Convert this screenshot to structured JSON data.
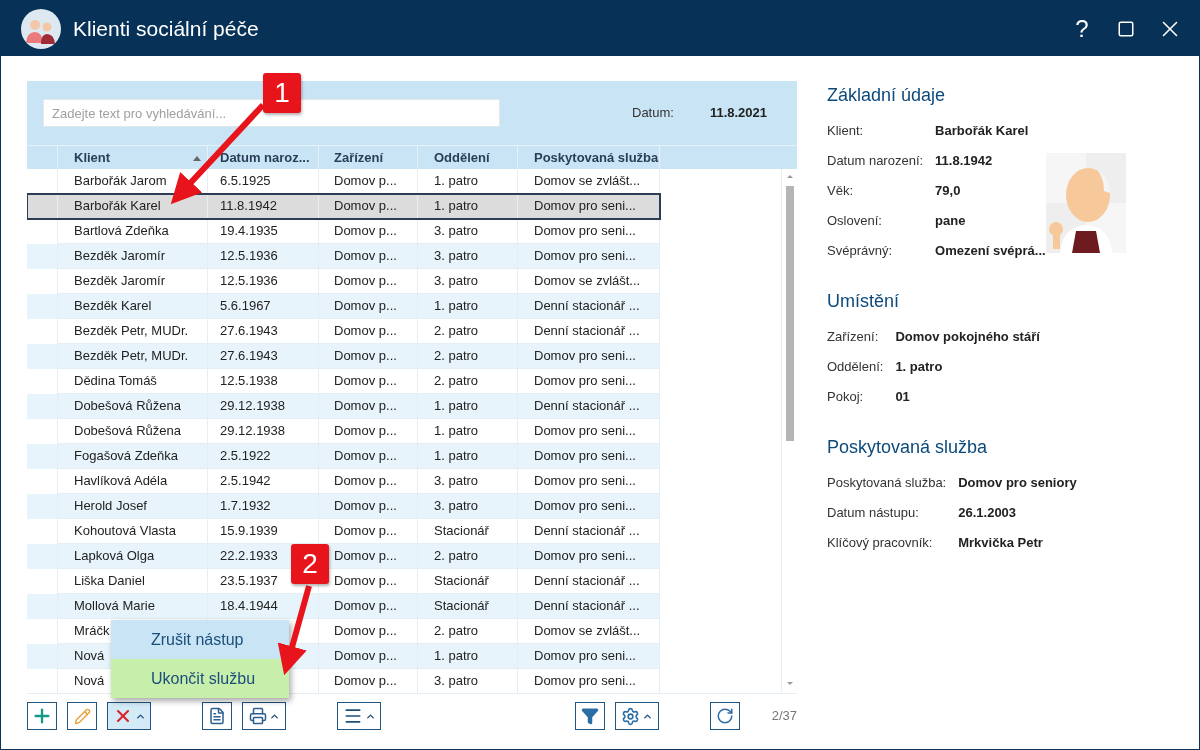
{
  "window": {
    "title": "Klienti sociální péče",
    "help": "?"
  },
  "search": {
    "placeholder": "Zadejte text pro vyhledávání..."
  },
  "date": {
    "label": "Datum:",
    "value": "11.8.2021"
  },
  "table": {
    "columns": [
      {
        "label": "Klient",
        "sorted": true
      },
      {
        "label": "Datum naroz...",
        "sorted": false
      },
      {
        "label": "Zařízení",
        "sorted": false
      },
      {
        "label": "Oddělení",
        "sorted": false
      },
      {
        "label": "Poskytovaná služba",
        "sorted": false
      }
    ],
    "rows": [
      {
        "cells": [
          "Barbořák Jarom",
          "6.5.1925",
          "Domov p...",
          "1. patro",
          "Domov se zvlášt..."
        ],
        "selected": false
      },
      {
        "cells": [
          "Barbořák Karel",
          "11.8.1942",
          "Domov p...",
          "1. patro",
          "Domov pro seni..."
        ],
        "selected": true
      },
      {
        "cells": [
          "Bartlová Zdeňka",
          "19.4.1935",
          "Domov p...",
          "3. patro",
          "Domov pro seni..."
        ],
        "selected": false
      },
      {
        "cells": [
          "Bezděk Jaromír",
          "12.5.1936",
          "Domov p...",
          "3. patro",
          "Domov pro seni..."
        ],
        "selected": false
      },
      {
        "cells": [
          "Bezděk Jaromír",
          "12.5.1936",
          "Domov p...",
          "3. patro",
          "Domov se zvlášt..."
        ],
        "selected": false
      },
      {
        "cells": [
          "Bezděk Karel",
          "5.6.1967",
          "Domov p...",
          "1. patro",
          "Denní stacionář ..."
        ],
        "selected": false
      },
      {
        "cells": [
          "Bezděk Petr, MUDr.",
          "27.6.1943",
          "Domov p...",
          "2. patro",
          "Denní stacionář ..."
        ],
        "selected": false
      },
      {
        "cells": [
          "Bezděk Petr, MUDr.",
          "27.6.1943",
          "Domov p...",
          "2. patro",
          "Domov pro seni..."
        ],
        "selected": false
      },
      {
        "cells": [
          "Dědina Tomáš",
          "12.5.1938",
          "Domov p...",
          "2. patro",
          "Domov pro seni..."
        ],
        "selected": false
      },
      {
        "cells": [
          "Dobešová Růžena",
          "29.12.1938",
          "Domov p...",
          "1. patro",
          "Denní stacionář ..."
        ],
        "selected": false
      },
      {
        "cells": [
          "Dobešová Růžena",
          "29.12.1938",
          "Domov p...",
          "1. patro",
          "Domov pro seni..."
        ],
        "selected": false
      },
      {
        "cells": [
          "Fogašová Zdeňka",
          "2.5.1922",
          "Domov p...",
          "1. patro",
          "Domov pro seni..."
        ],
        "selected": false
      },
      {
        "cells": [
          "Havlíková Adéla",
          "2.5.1942",
          "Domov p...",
          "3. patro",
          "Domov pro seni..."
        ],
        "selected": false
      },
      {
        "cells": [
          "Herold Josef",
          "1.7.1932",
          "Domov p...",
          "3. patro",
          "Domov pro seni..."
        ],
        "selected": false
      },
      {
        "cells": [
          "Kohoutová Vlasta",
          "15.9.1939",
          "Domov p...",
          "Stacionář",
          "Denní stacionář ..."
        ],
        "selected": false
      },
      {
        "cells": [
          "Lapková Olga",
          "22.2.1933",
          "Domov p...",
          "2. patro",
          "Domov pro seni..."
        ],
        "selected": false
      },
      {
        "cells": [
          "Liška Daniel",
          "23.5.1937",
          "Domov p...",
          "Stacionář",
          "Denní stacionář ..."
        ],
        "selected": false
      },
      {
        "cells": [
          "Mollová Marie",
          "18.4.1944",
          "Domov p...",
          "Stacionář",
          "Denní stacionář ..."
        ],
        "selected": false
      },
      {
        "cells": [
          "Mráčk",
          null,
          "Domov p...",
          "2. patro",
          "Domov se zvlášt..."
        ],
        "selected": false
      },
      {
        "cells": [
          "Nová",
          null,
          "Domov p...",
          "1. patro",
          "Domov pro seni..."
        ],
        "selected": false
      },
      {
        "cells": [
          "Nová",
          null,
          "Domov p...",
          "3. patro",
          "Domov pro seni..."
        ],
        "selected": false
      }
    ]
  },
  "toolbar": {
    "groups": [
      [
        {
          "kind": "add",
          "dropdown": false,
          "pressed": false
        },
        {
          "kind": "edit",
          "dropdown": false,
          "pressed": false
        },
        {
          "kind": "delete",
          "dropdown": true,
          "pressed": true
        }
      ],
      [
        {
          "kind": "document",
          "dropdown": false,
          "pressed": false
        },
        {
          "kind": "print",
          "dropdown": true,
          "pressed": false
        }
      ],
      [
        {
          "kind": "menu",
          "dropdown": true,
          "pressed": false
        }
      ],
      [
        {
          "kind": "filter",
          "dropdown": false,
          "pressed": false
        },
        {
          "kind": "settings",
          "dropdown": true,
          "pressed": false
        }
      ],
      [
        {
          "kind": "refresh",
          "dropdown": false,
          "pressed": false
        }
      ]
    ],
    "counter": "2/37"
  },
  "popup_menu": [
    {
      "label": "Zrušit nástup",
      "selected": false
    },
    {
      "label": "Ukončit službu",
      "selected": true
    }
  ],
  "details": [
    {
      "title": "Základní údaje",
      "fields": [
        {
          "label": "Klient:",
          "value": "Barbořák Karel"
        },
        {
          "label": "Datum narození:",
          "value": "11.8.1942"
        },
        {
          "label": "Věk:",
          "value": "79,0"
        },
        {
          "label": "Oslovení:",
          "value": "pane"
        },
        {
          "label": "Svéprávný:",
          "value": "Omezení svéprá..."
        }
      ]
    },
    {
      "title": "Umístění",
      "fields": [
        {
          "label": "Zařízení:",
          "value": "Domov pokojného stáří"
        },
        {
          "label": "Oddělení:",
          "value": "1. patro"
        },
        {
          "label": "Pokoj:",
          "value": "01"
        }
      ]
    },
    {
      "title": "Poskytovaná služba",
      "fields": [
        {
          "label": "Poskytovaná služba:",
          "value": "Domov pro seniory"
        },
        {
          "label": "Datum nástupu:",
          "value": "26.1.2003"
        },
        {
          "label": "Klíčový pracovník:",
          "value": "Mrkvička Petr"
        }
      ]
    }
  ],
  "callouts": [
    {
      "label": "1"
    },
    {
      "label": "2"
    }
  ]
}
